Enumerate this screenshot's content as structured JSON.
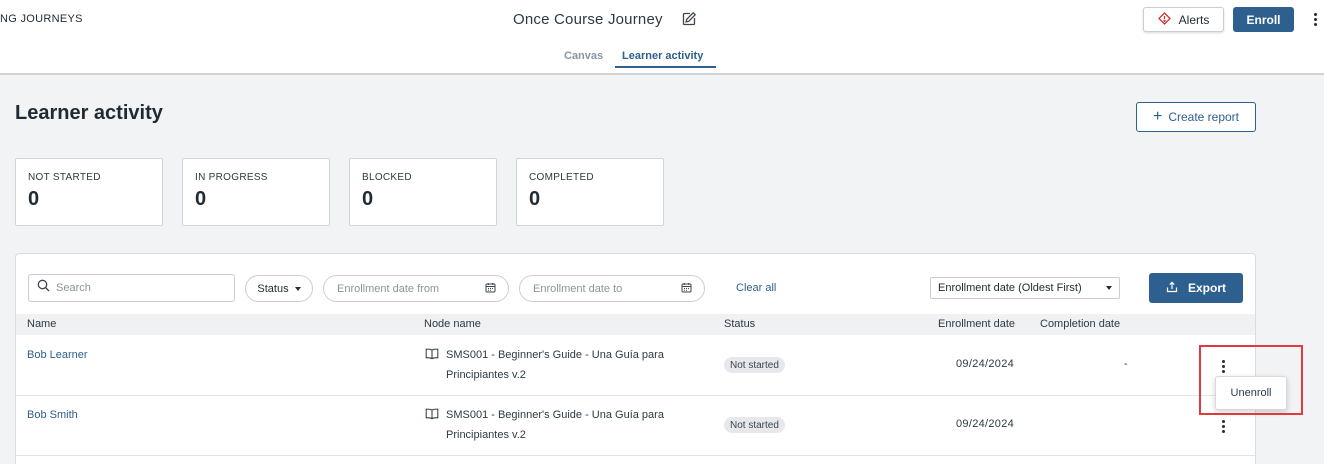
{
  "header": {
    "breadcrumb": "NG JOURNEYS",
    "title": "Once Course Journey",
    "alerts_label": "Alerts",
    "enroll_label": "Enroll",
    "tabs": [
      {
        "label": "Canvas",
        "active": false
      },
      {
        "label": "Learner activity",
        "active": true
      }
    ]
  },
  "page": {
    "title": "Learner activity",
    "create_report_label": "Create report"
  },
  "stats": [
    {
      "label": "NOT STARTED",
      "value": "0"
    },
    {
      "label": "IN PROGRESS",
      "value": "0"
    },
    {
      "label": "BLOCKED",
      "value": "0"
    },
    {
      "label": "COMPLETED",
      "value": "0"
    }
  ],
  "filters": {
    "search_placeholder": "Search",
    "status_label": "Status",
    "date_from_placeholder": "Enrollment date from",
    "date_to_placeholder": "Enrollment date to",
    "clear_all_label": "Clear all",
    "sort_value": "Enrollment date (Oldest First)",
    "export_label": "Export"
  },
  "table": {
    "columns": [
      "Name",
      "Node name",
      "Status",
      "Enrollment date",
      "Completion date"
    ],
    "rows": [
      {
        "name": "Bob Learner",
        "node_line1": "SMS001 - Beginner's Guide - Una Guía para",
        "node_line2": "Principiantes v.2",
        "status": "Not started",
        "enrollment_date": "09/24/2024",
        "completion_date": "-"
      },
      {
        "name": "Bob Smith",
        "node_line1": "SMS001 - Beginner's Guide - Una Guía para",
        "node_line2": "Principiantes v.2",
        "status": "Not started",
        "enrollment_date": "09/24/2024",
        "completion_date": "-"
      }
    ]
  },
  "row_menu": {
    "unenroll_label": "Unenroll"
  },
  "colors": {
    "accent": "#2d5f8f",
    "highlight": "#e0393e",
    "alert_icon": "#d0342c"
  }
}
